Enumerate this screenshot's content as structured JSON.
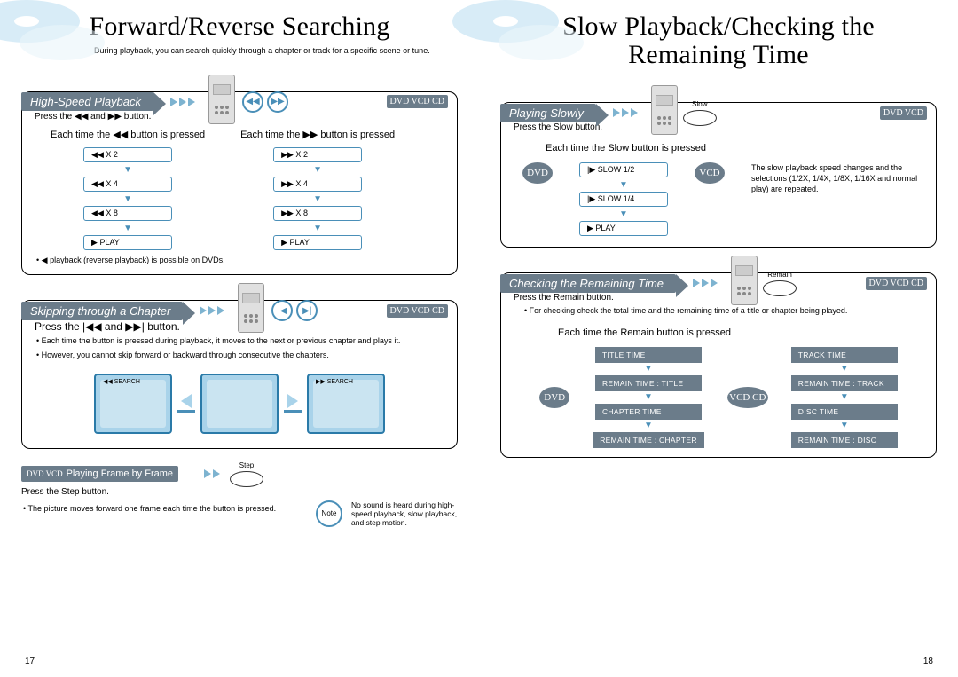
{
  "left": {
    "title": "Forward/Reverse Searching",
    "subtitle": "During playback, you can search quickly through a chapter or track for a specific scene or tune.",
    "page_num": "17",
    "highspeed": {
      "header": "High-Speed Playback",
      "disc_labels": "DVD VCD CD",
      "press": "Press the ◀◀ and ▶▶ button.",
      "each_rev": "Each time the    ◀◀ button is pressed",
      "each_fwd": "Each time the    ▶▶ button is pressed",
      "rev_steps": [
        "◀◀  X 2",
        "◀◀  X 4",
        "◀◀  X 8",
        "▶  PLAY"
      ],
      "fwd_steps": [
        "▶▶  X 2",
        "▶▶  X 4",
        "▶▶  X 8",
        "▶  PLAY"
      ],
      "note": "◀ playback (reverse playback) is possible on DVDs."
    },
    "skip": {
      "header": "Skipping through a Chapter",
      "disc_labels": "DVD VCD CD",
      "press": "Press the |◀◀ and ▶▶| button.",
      "b1": "Each time the button is pressed during playback, it moves to the next or previous chapter and plays it.",
      "b2": "However, you cannot skip forward or backward through consecutive the chapters.",
      "tv_rev": "◀◀ SEARCH",
      "tv_fwd": "▶▶ SEARCH"
    },
    "frame": {
      "disc_labels": "DVD VCD",
      "label": "Playing Frame by Frame",
      "step_label": "Step",
      "press": "Press the Step button.",
      "b1": "The picture moves forward one frame each time the button is pressed.",
      "note_label": "Note",
      "note_text": "No sound is heard during high-speed playback, slow playback, and step motion."
    }
  },
  "right": {
    "title_1": "Slow Playback/Checking the",
    "title_2": "Remaining Time",
    "page_num": "18",
    "slow": {
      "header": "Playing Slowly",
      "disc_labels": "DVD VCD",
      "btn_label": "Slow",
      "press": "Press the Slow button.",
      "each": "Each time the Slow button is pressed",
      "dvd_label": "DVD",
      "vcd_label": "VCD",
      "dvd_steps": [
        "|▶ SLOW 1/2",
        "|▶ SLOW 1/4",
        "▶ PLAY"
      ],
      "info": "The slow playback speed changes and the selections (1/2X, 1/4X, 1/8X, 1/16X and normal play) are repeated."
    },
    "remain": {
      "header": "Checking the Remaining Time",
      "disc_labels": "DVD VCD CD",
      "btn_label": "Remain",
      "press": "Press the Remain button.",
      "b1": "For checking check the total time and the remaining time of a title or chapter being played.",
      "each": "Each time the Remain button is pressed",
      "dvd_label": "DVD",
      "vcd_cd_label": "VCD CD",
      "dvd_steps": [
        "TITLE TIME",
        "REMAIN TIME : TITLE",
        "CHAPTER TIME",
        "REMAIN TIME : CHAPTER"
      ],
      "cd_steps": [
        "TRACK TIME",
        "REMAIN TIME : TRACK",
        "DISC TIME",
        "REMAIN TIME : DISC"
      ]
    }
  }
}
